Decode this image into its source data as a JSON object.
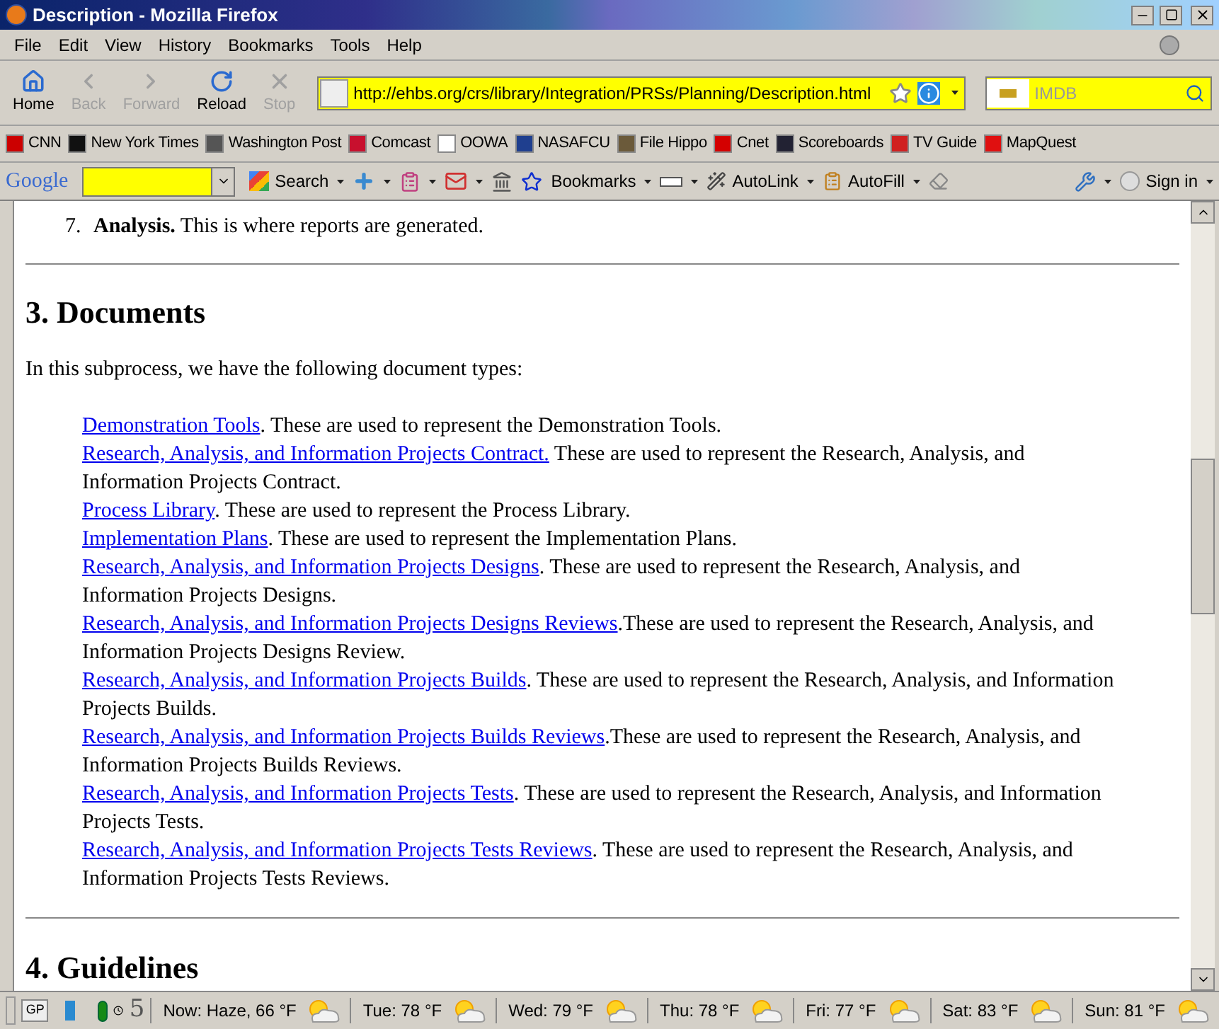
{
  "window": {
    "title": "Description - Mozilla Firefox"
  },
  "menu": [
    "File",
    "Edit",
    "View",
    "History",
    "Bookmarks",
    "Tools",
    "Help"
  ],
  "nav_buttons": [
    {
      "kind": "home",
      "label": "Home",
      "disabled": false
    },
    {
      "kind": "back",
      "label": "Back",
      "disabled": true
    },
    {
      "kind": "forward",
      "label": "Forward",
      "disabled": true
    },
    {
      "kind": "reload",
      "label": "Reload",
      "disabled": false
    },
    {
      "kind": "stop",
      "label": "Stop",
      "disabled": true
    }
  ],
  "address": {
    "value": "http://ehbs.org/crs/library/Integration/PRSs/Planning/Description.html"
  },
  "search": {
    "placeholder": "IMDB"
  },
  "bookmarks": [
    {
      "label": "CNN",
      "color": "#cc0000"
    },
    {
      "label": "New York Times",
      "color": "#111111"
    },
    {
      "label": "Washington Post",
      "color": "#555555"
    },
    {
      "label": "Comcast",
      "color": "#c8102e"
    },
    {
      "label": "OOWA",
      "color": "#ffffff"
    },
    {
      "label": "NASAFCU",
      "color": "#1f3f8f"
    },
    {
      "label": "File Hippo",
      "color": "#6b5a3a"
    },
    {
      "label": "Cnet",
      "color": "#d40000"
    },
    {
      "label": "Scoreboards",
      "color": "#222233"
    },
    {
      "label": "TV Guide",
      "color": "#d02020"
    },
    {
      "label": "MapQuest",
      "color": "#e01010"
    }
  ],
  "google_toolbar": {
    "logo": "Google",
    "search_button": "Search",
    "bookmarks": "Bookmarks",
    "autolink": "AutoLink",
    "autofill": "AutoFill",
    "sign_in": "Sign in"
  },
  "content": {
    "list_item": {
      "number": "7.",
      "text": "**Analysis.** This is where reports are generated."
    },
    "heading": "3. Documents",
    "intro": "In this subprocess, we have the following document types:",
    "documents": [
      {
        "link": "Demonstration Tools",
        "text": ". These are used to represent the Demonstration Tools."
      },
      {
        "link": "Research, Analysis, and Information Projects Contract.",
        "text": " These are used to represent the Research, Analysis, and Information Projects Contract."
      },
      {
        "link": "Process Library",
        "text": ". These are used to represent the Process Library."
      },
      {
        "link": "Implementation Plans",
        "text": ". These are used to represent the Implementation Plans."
      },
      {
        "link": "Research, Analysis, and Information Projects Designs",
        "text": ". These are used to represent the Research, Analysis, and Information Projects Designs."
      },
      {
        "link": "Research, Analysis, and Information Projects Designs Reviews",
        "text": ".These are used to represent the Research, Analysis, and Information Projects Designs Review."
      },
      {
        "link": "Research, Analysis, and Information Projects Builds",
        "text": ". These are used to represent the Research, Analysis, and Information Projects Builds."
      },
      {
        "link": "Research, Analysis, and Information Projects Builds Reviews",
        "text": ".These are used to represent the Research, Analysis, and Information Projects Builds Reviews."
      },
      {
        "link": "Research, Analysis, and Information Projects Tests",
        "text": ". These are used to represent the Research, Analysis, and Information Projects Tests."
      },
      {
        "link": "Research, Analysis, and Information Projects Tests Reviews",
        "text": ". These are used to represent the Research, Analysis, and Information Projects Tests Reviews."
      }
    ],
    "next_heading": "4. Guidelines"
  },
  "status_bar": {
    "gp": "GP",
    "count": "5",
    "weather": [
      "Now: Haze, 66 °F",
      "Tue: 78 °F",
      "Wed: 79 °F",
      "Thu: 78 °F",
      "Fri: 77 °F",
      "Sat: 83 °F",
      "Sun: 81 °F"
    ]
  }
}
